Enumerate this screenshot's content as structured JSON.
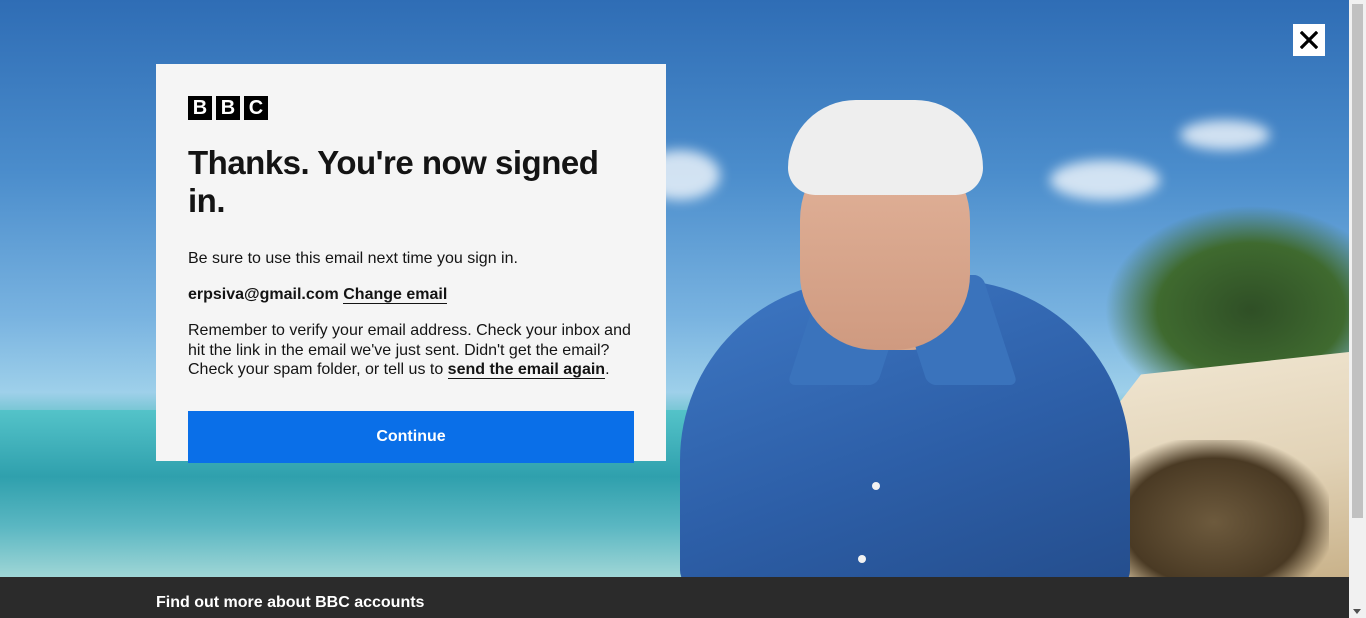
{
  "dialog": {
    "logo_letters": [
      "B",
      "B",
      "C"
    ],
    "title": "Thanks. You're now signed in.",
    "intro": "Be sure to use this email next time you sign in.",
    "email": "erpsiva@gmail.com",
    "change_email_label": "Change email",
    "verify_text_before": "Remember to verify your email address. Check your inbox and hit the link in the email we've just sent. Didn't get the email? Check your spam folder, or tell us to ",
    "resend_link_label": "send the email again",
    "verify_text_after": ".",
    "continue_label": "Continue"
  },
  "close_button": {
    "icon": "close-icon"
  },
  "footer": {
    "link_label": "Find out more about BBC accounts"
  },
  "colors": {
    "primary_button": "#0a6fe8",
    "footer_bg": "#2b2b2b",
    "card_bg": "#f5f5f5"
  }
}
